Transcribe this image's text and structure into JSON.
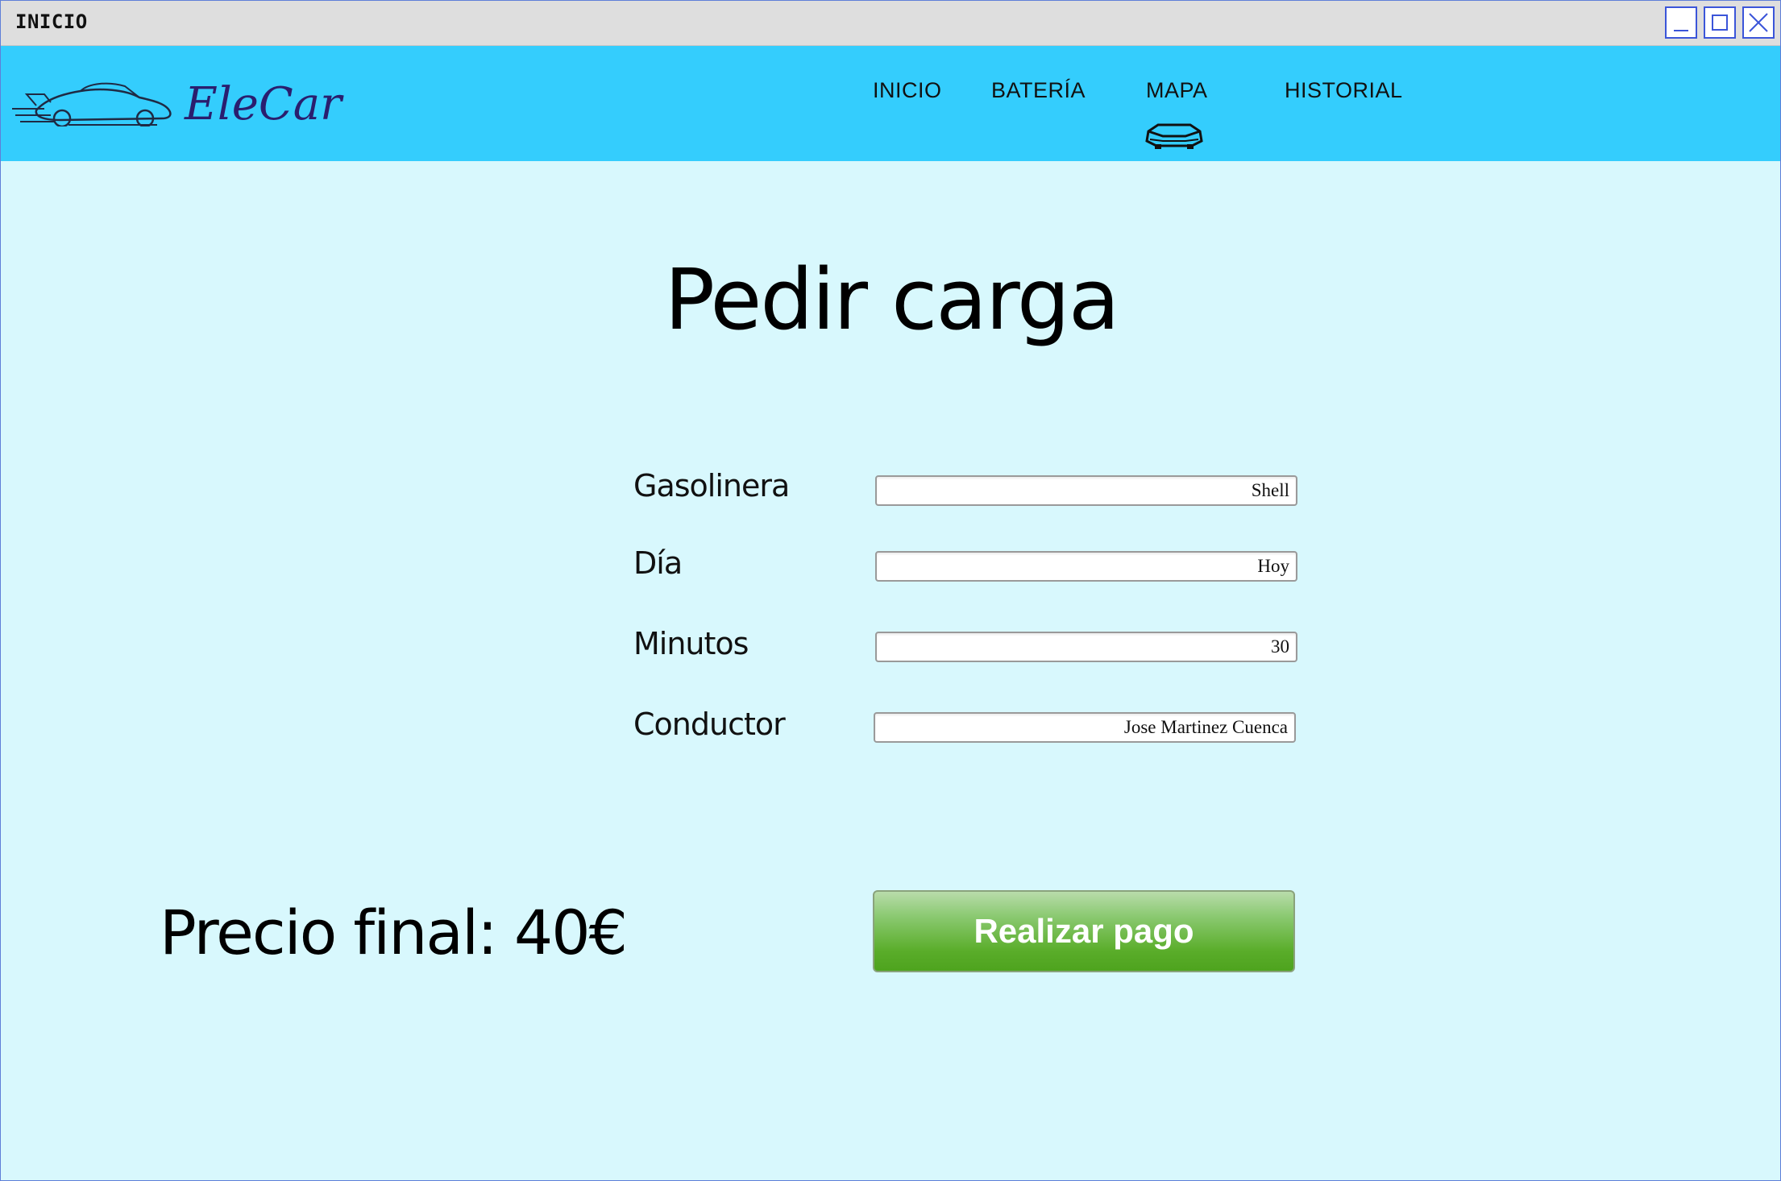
{
  "window": {
    "title": "INICIO"
  },
  "app": {
    "brand": "EleCar"
  },
  "nav": {
    "items": [
      {
        "label": "INICIO"
      },
      {
        "label": "BATERÍA"
      },
      {
        "label": "MAPA",
        "active_icon": "car-icon"
      },
      {
        "label": "HISTORIAL"
      }
    ]
  },
  "page": {
    "title": "Pedir carga"
  },
  "form": {
    "gasolinera": {
      "label": "Gasolinera",
      "value": "Shell"
    },
    "dia": {
      "label": "Día",
      "value": "Hoy"
    },
    "minutos": {
      "label": "Minutos",
      "value": "30"
    },
    "conductor": {
      "label": "Conductor",
      "value": "Jose Martinez Cuenca"
    }
  },
  "price": {
    "text": "Precio final: 40€"
  },
  "actions": {
    "pay_label": "Realizar pago"
  },
  "colors": {
    "navbar": "#34cdfd",
    "background": "#d8f8fd",
    "button_green": "#5aad2a",
    "window_controls": "#3b55d9"
  }
}
